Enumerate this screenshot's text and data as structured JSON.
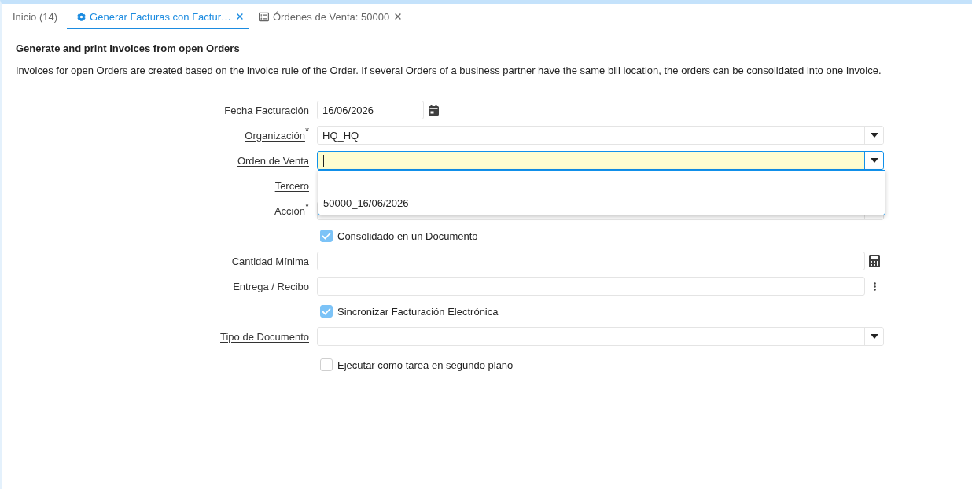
{
  "tabs": [
    {
      "kind": "home",
      "label": "Inicio (14)",
      "selected": false,
      "closable": false
    },
    {
      "kind": "process",
      "label": "Generar Facturas con Factur…",
      "selected": true,
      "closable": true
    },
    {
      "kind": "window",
      "label": "Órdenes de Venta: 50000",
      "selected": false,
      "closable": true
    }
  ],
  "header": {
    "title": "Generate and print Invoices from open Orders",
    "description": "Invoices for open Orders are created based on the invoice rule of the Order. If several Orders of a business partner have the same bill location, the orders can be consolidated into one Invoice."
  },
  "form": {
    "fields": [
      {
        "kind": "date",
        "label": "Fecha Facturación",
        "linked": false,
        "focused": false,
        "value": "16/06/2026"
      },
      {
        "kind": "select",
        "label": "Organización",
        "linked": true,
        "required_mark": "*",
        "focused": false,
        "value": "HQ_HQ"
      },
      {
        "kind": "select",
        "label": "Orden de Venta",
        "linked": true,
        "focused": true,
        "dropdown": {
          "options": [
            {
              "kind": "empty"
            },
            {
              "kind": "entry",
              "label": "50000_16/06/2026"
            }
          ]
        }
      },
      {
        "kind": "covered",
        "label": "Tercero",
        "linked": true
      },
      {
        "kind": "select",
        "label": "Acción",
        "linked": false,
        "required_mark": "*",
        "focused": false
      },
      {
        "kind": "checkbox",
        "label": "Consolidado en un Documento",
        "checked": true
      },
      {
        "kind": "number",
        "label": "Cantidad Mínima",
        "linked": false,
        "focused": false
      },
      {
        "kind": "search",
        "label": "Entrega / Recibo",
        "linked": true,
        "focused": false
      },
      {
        "kind": "checkbox",
        "label": "Sincronizar Facturación Electrónica",
        "checked": true
      },
      {
        "kind": "select",
        "label": "Tipo de Documento",
        "linked": true,
        "focused": false
      }
    ]
  },
  "background_task": {
    "label": "Ejecutar como tarea en segundo plano",
    "checked": false
  }
}
